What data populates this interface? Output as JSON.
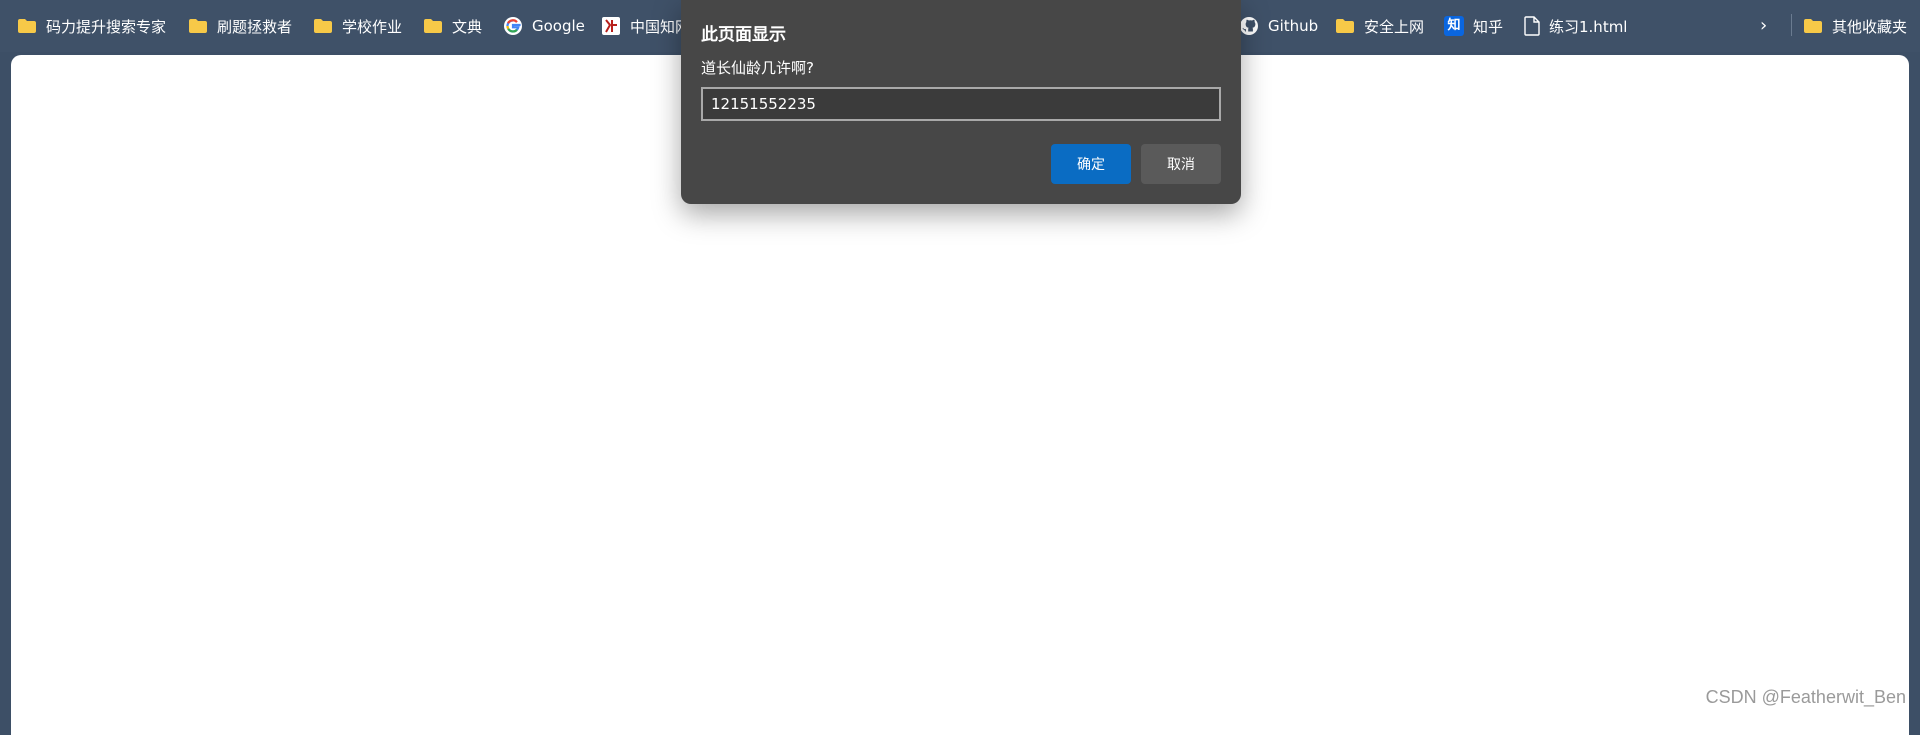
{
  "bookmarks_bar": {
    "items": [
      {
        "label": "码力提升搜索专家",
        "icon": "folder-icon"
      },
      {
        "label": "刷题拯救者",
        "icon": "folder-icon"
      },
      {
        "label": "学校作业",
        "icon": "folder-icon"
      },
      {
        "label": "文典",
        "icon": "folder-icon"
      },
      {
        "label": "Google",
        "icon": "google-icon"
      },
      {
        "label": "中国知网",
        "icon": "cnki-icon"
      },
      {
        "label": "Github",
        "icon": "github-icon"
      },
      {
        "label": "安全上网",
        "icon": "folder-icon"
      },
      {
        "label": "知乎",
        "icon": "zhihu-icon"
      },
      {
        "label": "练习1.html",
        "icon": "file-icon"
      }
    ],
    "zhihu_glyph": "知",
    "overflow_glyph": "›",
    "other_bookmarks": {
      "label": "其他收藏夹",
      "icon": "folder-icon"
    }
  },
  "dialog": {
    "title": "此页面显示",
    "message": "道长仙龄几许啊?",
    "input_value": "12151552235",
    "ok_label": "确定",
    "cancel_label": "取消"
  },
  "watermark": "CSDN @Featherwit_Ben",
  "colors": {
    "bar_bg": "#3f5168",
    "folder": "#f7c948",
    "dialog_bg": "#474747",
    "ok_button": "#0a6cc3",
    "cancel_button": "#5a5a5a"
  }
}
